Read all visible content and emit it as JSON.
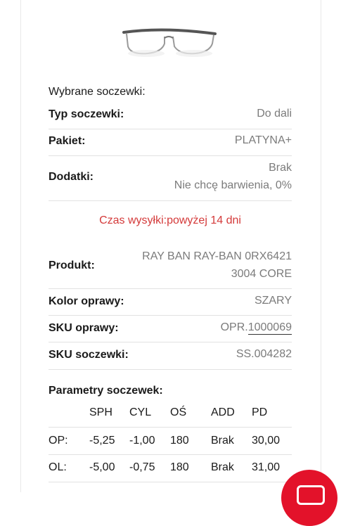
{
  "selected_lenses_title": "Wybrane soczewki:",
  "lens_info": [
    {
      "label": "Typ soczewki:",
      "value": "Do dali"
    },
    {
      "label": "Pakiet:",
      "value": "PLATYNA+"
    },
    {
      "label": "Dodatki:",
      "value_line1": "Brak",
      "value_line2": "Nie chcę barwienia, 0%"
    }
  ],
  "shipping_time": "Czas wysyłki:powyżej 14 dni",
  "product_info": {
    "product_label": "Produkt:",
    "product_value_line1": "RAY BAN RAY-BAN 0RX6421",
    "product_value_line2": "3004 CORE",
    "frame_color_label": "Kolor oprawy:",
    "frame_color_value": "SZARY",
    "frame_sku_label": "SKU oprawy:",
    "frame_sku_prefix": "OPR.",
    "frame_sku_number": "1000069",
    "lens_sku_label": "SKU soczewki:",
    "lens_sku_value": "SS.004282"
  },
  "params": {
    "title": "Parametry soczewek:",
    "headers": [
      "SPH",
      "CYL",
      "OŚ",
      "ADD",
      "PD"
    ],
    "rows": [
      {
        "eye": "OP:",
        "values": [
          "-5,25",
          "-1,00",
          "180",
          "Brak",
          "30,00"
        ]
      },
      {
        "eye": "OL:",
        "values": [
          "-5,00",
          "-0,75",
          "180",
          "Brak",
          "31,00"
        ]
      }
    ]
  },
  "icons": {
    "product_image": "eyeglasses-icon",
    "chat": "chat-bubble-icon"
  },
  "colors": {
    "shipping_text": "#d43a3a",
    "chat_button": "#e3122a",
    "value_text": "#7b7b7b"
  }
}
